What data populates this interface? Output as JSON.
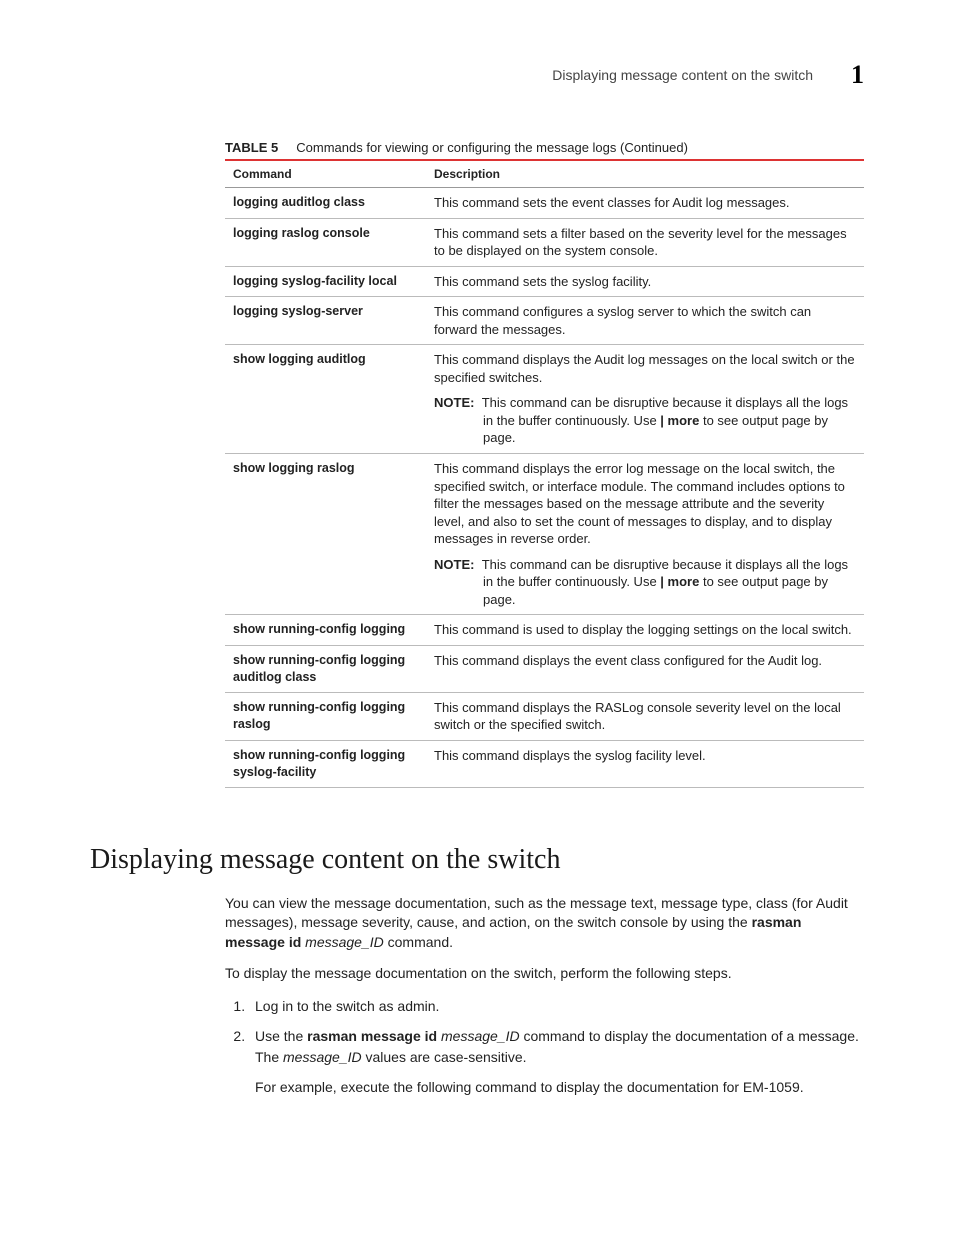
{
  "header": {
    "title": "Displaying message content on the switch",
    "chapter": "1"
  },
  "table": {
    "label": "TABLE 5",
    "caption": "Commands for viewing or configuring the message logs (Continued)",
    "col1": "Command",
    "col2": "Description",
    "rows": [
      {
        "cmd": "logging auditlog class",
        "desc": "This command sets the event classes for Audit log messages."
      },
      {
        "cmd": "logging raslog console",
        "desc": "This command sets a filter based on the severity level for the messages to be displayed on the system console."
      },
      {
        "cmd": "logging syslog-facility local",
        "desc": "This command sets the syslog facility."
      },
      {
        "cmd": "logging syslog-server",
        "desc": "This command configures a syslog server to which the switch can forward the messages."
      },
      {
        "cmd": "show logging auditlog",
        "desc": "This command displays the Audit log messages on the local switch or the specified switches.",
        "note_label": "NOTE:",
        "note_pre": "This command can be disruptive because it displays all the logs in the buffer continuously. Use ",
        "note_bold": "| more",
        "note_post": " to see output page by page."
      },
      {
        "cmd": "show logging raslog",
        "desc": "This command displays the error log message on the local switch, the specified switch, or interface module. The command includes options to filter the messages based on the message attribute and the severity level, and also to set the count of messages to display, and to display messages in reverse order.",
        "note_label": "NOTE:",
        "note_pre": "This command can be disruptive because it displays all the logs in the buffer continuously. Use ",
        "note_bold": "| more",
        "note_post": " to see output page by page."
      },
      {
        "cmd": "show running-config logging",
        "desc": "This command is used to display the logging settings on the local switch."
      },
      {
        "cmd": "show running-config logging auditlog class",
        "desc": "This command displays the event class configured for the Audit log."
      },
      {
        "cmd": "show running-config logging raslog",
        "desc": "This command displays the RASLog console severity level on the local switch or the specified switch."
      },
      {
        "cmd": "show running-config logging syslog-facility",
        "desc": "This command displays the syslog facility level."
      }
    ]
  },
  "section": {
    "heading": "Displaying message content on the switch",
    "p1_a": "You can view the message documentation, such as the message text, message type, class (for Audit messages), message severity, cause, and action, on the switch console by using the ",
    "p1_cmd": "rasman message id",
    "p1_b": " ",
    "p1_arg": "message_ID",
    "p1_c": " command.",
    "p2": "To display the message documentation on the switch, perform the following steps.",
    "step1": "Log in to the switch as admin.",
    "step2_a": "Use the ",
    "step2_cmd": "rasman message id",
    "step2_b": " ",
    "step2_arg": "message_ID",
    "step2_c": " command to display the documentation of a message. The ",
    "step2_arg2": "message_ID",
    "step2_d": " values are case-sensitive.",
    "step2_sub": "For example, execute the following command to display the documentation for EM-1059."
  }
}
